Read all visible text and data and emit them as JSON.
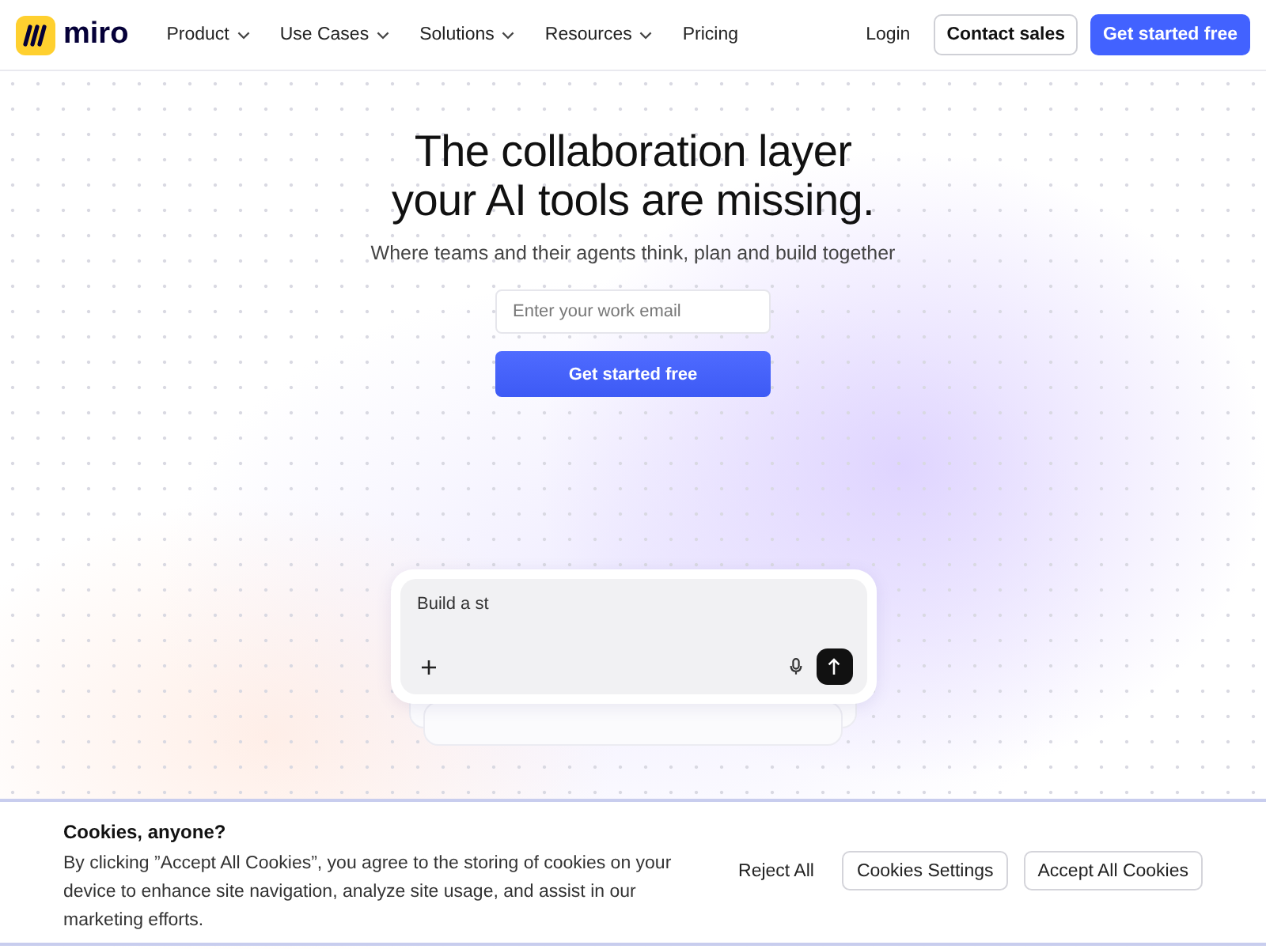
{
  "header": {
    "logo": {
      "text": "miro"
    },
    "nav": [
      {
        "label": "Product",
        "dropdown": true
      },
      {
        "label": "Use Cases",
        "dropdown": true
      },
      {
        "label": "Solutions",
        "dropdown": true
      },
      {
        "label": "Resources",
        "dropdown": true
      },
      {
        "label": "Pricing",
        "dropdown": false
      }
    ],
    "login": "Login",
    "contact_button": "Contact sales",
    "cta_button": "Get started free"
  },
  "hero": {
    "title_lines": [
      "The collaboration layer",
      "your AI tools are missing."
    ],
    "subtitle": "Where teams and their agents think, plan and build together",
    "email_field": {
      "placeholder": "Enter your work email"
    },
    "cta_button": "Get started free"
  },
  "prompt_box": {
    "value": "Build a st"
  },
  "cookie_banner": {
    "title": "Cookies, anyone?",
    "body": "By clicking ”Accept All Cookies”, you agree to the storing of cookies on your device to enhance site navigation, analyze site usage, and assist in our marketing efforts.",
    "buttons": [
      {
        "label": "Reject All",
        "kind": "text"
      },
      {
        "label": "Cookies Settings",
        "kind": "outline"
      },
      {
        "label": "Accept All Cookies",
        "kind": "outline"
      }
    ]
  }
}
